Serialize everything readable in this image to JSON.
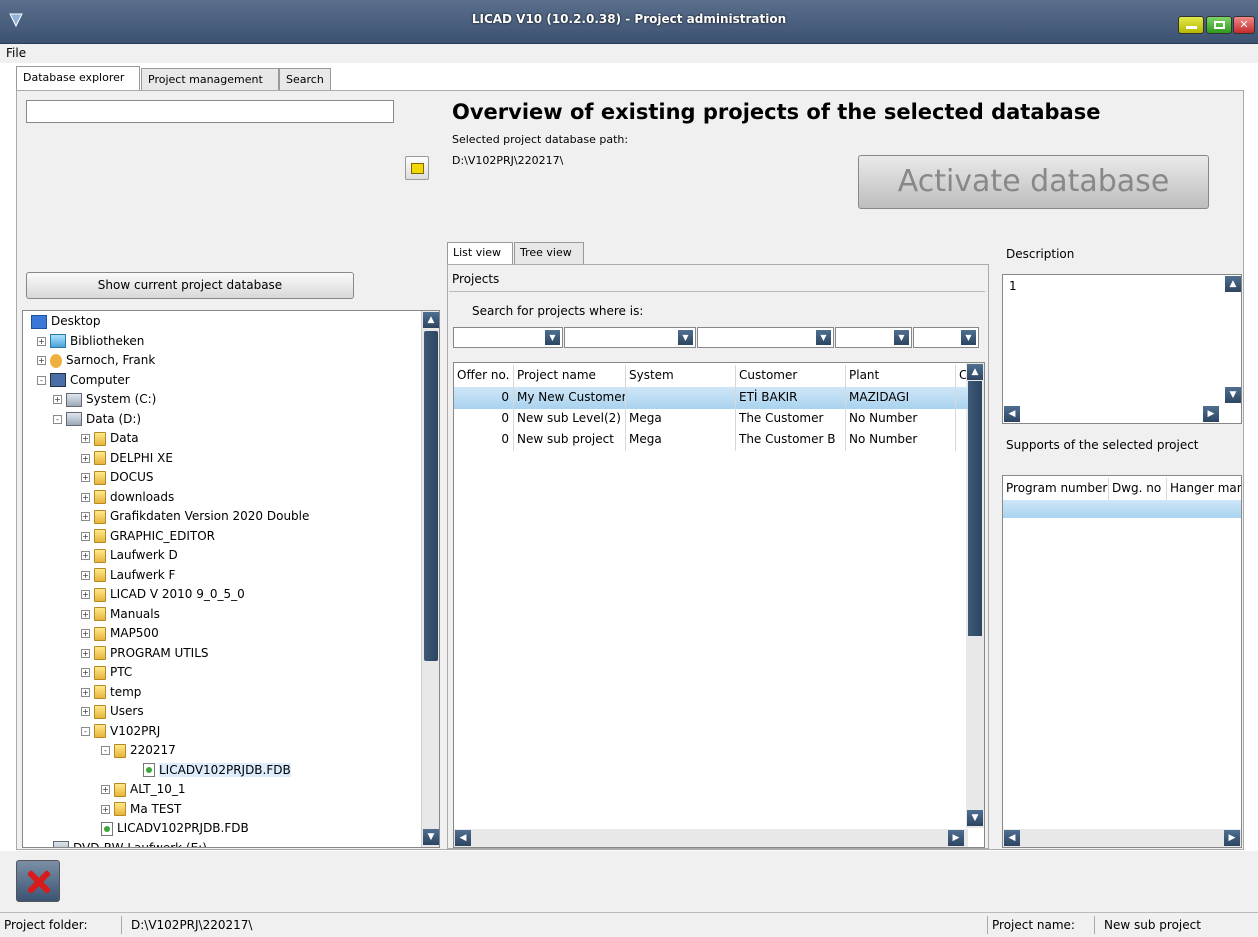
{
  "window": {
    "title": "LICAD V10 (10.2.0.38) - Project administration",
    "buttons": [
      "minimize",
      "maximize",
      "close"
    ]
  },
  "menu": {
    "file": "File"
  },
  "tabs": [
    "Database explorer",
    "Project management",
    "Search"
  ],
  "explorer": {
    "path_value": "",
    "show_button": "Show current project database",
    "tree": [
      {
        "label": "Desktop",
        "icon": "desktop-icon",
        "level": 0,
        "expander": ""
      },
      {
        "label": "Bibliotheken",
        "icon": "library-icon",
        "level": 1,
        "expander": "+"
      },
      {
        "label": "Sarnoch, Frank",
        "icon": "user-icon",
        "level": 1,
        "expander": "+"
      },
      {
        "label": "Computer",
        "icon": "computer-icon",
        "level": 1,
        "expander": "-"
      },
      {
        "label": "System (C:)",
        "icon": "drive-icon",
        "level": 2,
        "expander": "+"
      },
      {
        "label": "Data (D:)",
        "icon": "drive-icon",
        "level": 2,
        "expander": "-"
      },
      {
        "label": "Data",
        "icon": "folder-icon",
        "level": 3,
        "expander": "+"
      },
      {
        "label": "DELPHI XE",
        "icon": "folder-icon",
        "level": 3,
        "expander": "+"
      },
      {
        "label": "DOCUS",
        "icon": "folder-icon",
        "level": 3,
        "expander": "+"
      },
      {
        "label": "downloads",
        "icon": "folder-icon",
        "level": 3,
        "expander": "+"
      },
      {
        "label": "Grafikdaten Version 2020 Double",
        "icon": "folder-icon",
        "level": 3,
        "expander": "+"
      },
      {
        "label": "GRAPHIC_EDITOR",
        "icon": "folder-icon",
        "level": 3,
        "expander": "+"
      },
      {
        "label": "Laufwerk D",
        "icon": "folder-icon",
        "level": 3,
        "expander": "+"
      },
      {
        "label": "Laufwerk F",
        "icon": "folder-icon",
        "level": 3,
        "expander": "+"
      },
      {
        "label": "LICAD V 2010 9_0_5_0",
        "icon": "folder-icon",
        "level": 3,
        "expander": "+"
      },
      {
        "label": "Manuals",
        "icon": "folder-icon",
        "level": 3,
        "expander": "+"
      },
      {
        "label": "MAP500",
        "icon": "folder-icon",
        "level": 3,
        "expander": "+"
      },
      {
        "label": "PROGRAM UTILS",
        "icon": "folder-icon",
        "level": 3,
        "expander": "+"
      },
      {
        "label": "PTC",
        "icon": "folder-icon",
        "level": 3,
        "expander": "+"
      },
      {
        "label": "temp",
        "icon": "folder-icon",
        "level": 3,
        "expander": "+"
      },
      {
        "label": "Users",
        "icon": "folder-icon",
        "level": 3,
        "expander": "+"
      },
      {
        "label": "V102PRJ",
        "icon": "folder-icon",
        "level": 3,
        "expander": "-"
      },
      {
        "label": "220217",
        "icon": "folder-icon",
        "level": 4,
        "expander": "-"
      },
      {
        "label": "LICADV102PRJDB.FDB",
        "icon": "database-file-icon",
        "level": 5,
        "expander": "",
        "selected": true
      },
      {
        "label": "ALT_10_1",
        "icon": "folder-icon",
        "level": 4,
        "expander": "+"
      },
      {
        "label": "Ma TEST",
        "icon": "folder-icon",
        "level": 4,
        "expander": "+"
      },
      {
        "label": "LICADV102PRJDB.FDB",
        "icon": "database-file-icon",
        "level": 4,
        "expander": ""
      },
      {
        "label": "DVD-RW-Laufwerk (E:)",
        "icon": "dvd-drive-icon",
        "level": 2,
        "expander": ""
      }
    ]
  },
  "overview": {
    "title": "Overview of existing projects of the selected database",
    "path_label": "Selected project database path:",
    "path_value": "D:\\V102PRJ\\220217\\",
    "activate_button": "Activate database"
  },
  "view_tabs": [
    "List view",
    "Tree view"
  ],
  "projects": {
    "heading": "Projects",
    "search_label": "Search for projects where is:",
    "columns": [
      "Offer no.",
      "Project name",
      "System",
      "Customer",
      "Plant",
      "C"
    ],
    "rows": [
      [
        "0",
        "My New Customer",
        "",
        "ETİ BAKIR",
        "MAZIDAGI"
      ],
      [
        "0",
        "New sub Level(2)",
        "Mega",
        "The Customer",
        "No Number"
      ],
      [
        "0",
        "New sub project",
        "Mega",
        "The Customer B",
        "No Number"
      ]
    ]
  },
  "description": {
    "label": "Description",
    "text": "1"
  },
  "supports": {
    "label": "Supports of the selected project",
    "columns": [
      "Program number",
      "Dwg. no",
      "Hanger marl"
    ]
  },
  "statusbar": {
    "folder_label": "Project folder:",
    "folder_value": "D:\\V102PRJ\\220217\\",
    "name_label": "Project name:",
    "name_value": "New sub project"
  }
}
